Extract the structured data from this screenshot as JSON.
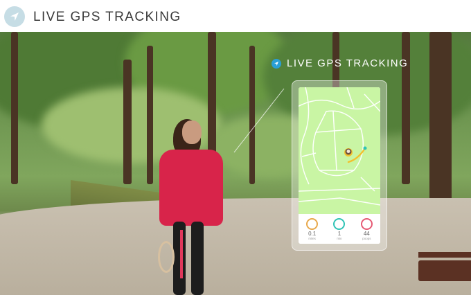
{
  "header": {
    "title": "LIVE GPS TRACKING",
    "icon": "navigation-arrow-icon"
  },
  "overlay": {
    "title": "LIVE GPS TRACKING",
    "icon": "location-dot-icon"
  },
  "phone": {
    "stats": [
      {
        "icon": "distance-icon",
        "value": "0.1",
        "unit": "miles",
        "color": "#e8a84b"
      },
      {
        "icon": "timer-icon",
        "value": "1",
        "unit": "min",
        "color": "#2fc3b5"
      },
      {
        "icon": "paw-icon",
        "value": "44",
        "unit": "poops",
        "color": "#e65a74"
      }
    ]
  },
  "colors": {
    "header_icon_bg": "#c6dde5",
    "map_bg": "#c9f5a4",
    "route": "#f2c12e",
    "jacket": "#d8244a"
  }
}
